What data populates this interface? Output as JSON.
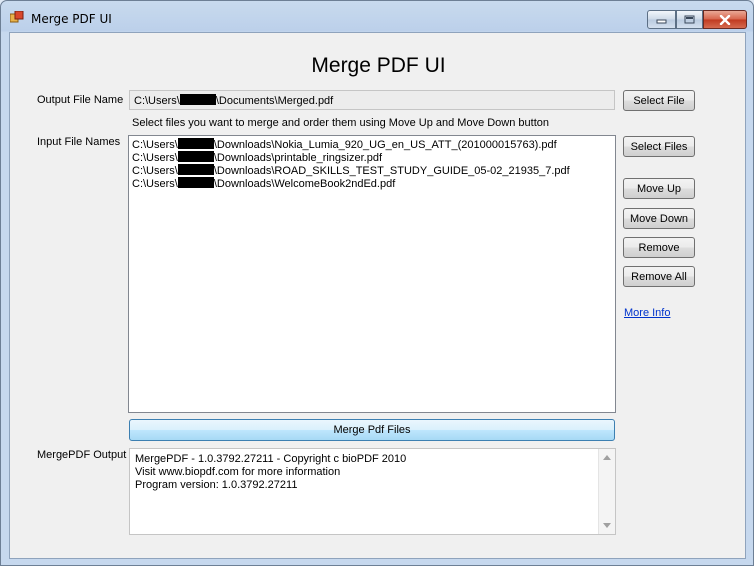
{
  "window": {
    "title": "Merge PDF UI",
    "controls": [
      "minimize",
      "maximize",
      "close"
    ]
  },
  "heading": "Merge PDF UI",
  "output_file": {
    "label": "Output File Name",
    "value_prefix": "C:\\Users\\",
    "value_suffix": "\\Documents\\Merged.pdf",
    "button": "Select File"
  },
  "instruction": "Select files you want to merge and order them using Move Up and Move Down button",
  "input_files": {
    "label": "Input File Names",
    "items": [
      {
        "prefix": "C:\\Users\\",
        "suffix": "\\Downloads\\Nokia_Lumia_920_UG_en_US_ATT_(201000015763).pdf"
      },
      {
        "prefix": "C:\\Users\\",
        "suffix": "\\Downloads\\printable_ringsizer.pdf"
      },
      {
        "prefix": "C:\\Users\\",
        "suffix": "\\Downloads\\ROAD_SKILLS_TEST_STUDY_GUIDE_05-02_21935_7.pdf"
      },
      {
        "prefix": "C:\\Users\\",
        "suffix": "\\Downloads\\WelcomeBook2ndEd.pdf"
      }
    ]
  },
  "buttons": {
    "select_files": "Select Files",
    "move_up": "Move Up",
    "move_down": "Move Down",
    "remove": "Remove",
    "remove_all": "Remove All",
    "merge": "Merge Pdf Files"
  },
  "more_info": "More Info",
  "output_log": {
    "label": "MergePDF Output",
    "lines": [
      "MergePDF - 1.0.3792.27211 - Copyright c bioPDF 2010",
      "Visit www.biopdf.com for more information",
      "Program version: 1.0.3792.27211"
    ]
  },
  "colors": {
    "title_bar": "#bcd0ea",
    "client_bg": "#f0f0f0",
    "close_button": "#c0391f",
    "merge_button": "#bee6fd",
    "link": "#0033cc"
  }
}
